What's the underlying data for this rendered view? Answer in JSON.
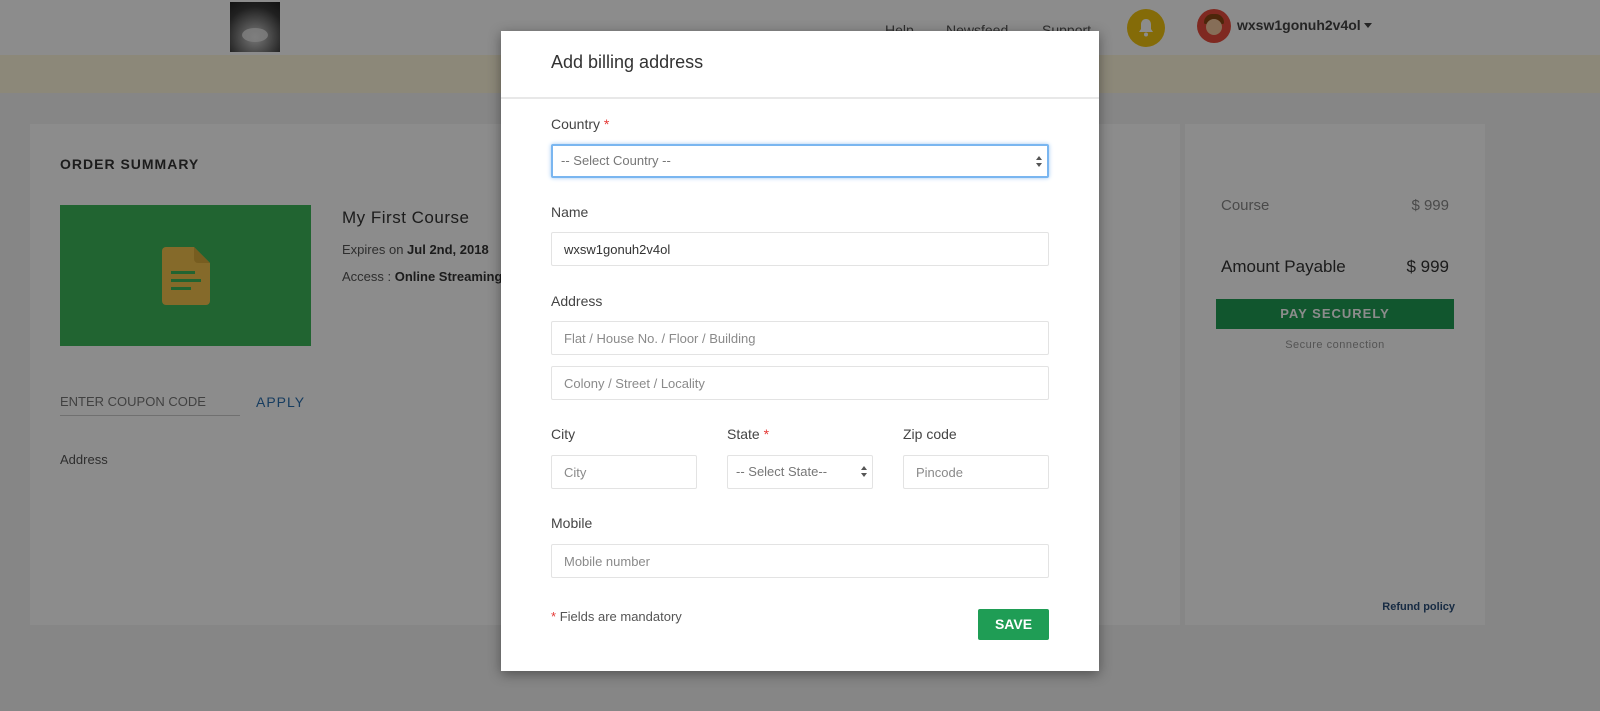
{
  "topbar": {
    "nav": [
      "Help",
      "Newsfeed",
      "Support"
    ],
    "username": "wxsw1gonuh2v4ol"
  },
  "order": {
    "title": "ORDER SUMMARY",
    "course_name": "My First Course",
    "expires_prefix": "Expires on",
    "expires_date": "Jul 2nd, 2018",
    "access_prefix": "Access :",
    "access_value": "Online Streaming",
    "coupon_placeholder": "ENTER COUPON CODE",
    "apply_label": "APPLY",
    "address_label": "Address"
  },
  "payment": {
    "course_label": "Course",
    "course_price": "$ 999",
    "payable_label": "Amount Payable",
    "payable_price": "$ 999",
    "pay_button": "PAY SECURELY",
    "secure_text": "Secure connection",
    "refund_link": "Refund policy"
  },
  "modal": {
    "title": "Add billing address",
    "country_label": "Country",
    "country_value": "-- Select Country --",
    "name_label": "Name",
    "name_value": "wxsw1gonuh2v4ol",
    "address_label": "Address",
    "address_line1_placeholder": "Flat / House No. / Floor / Building",
    "address_line2_placeholder": "Colony / Street / Locality",
    "city_label": "City",
    "city_placeholder": "City",
    "state_label": "State",
    "state_value": "-- Select State--",
    "zip_label": "Zip code",
    "zip_placeholder": "Pincode",
    "mobile_label": "Mobile",
    "mobile_placeholder": "Mobile number",
    "required_mark": "*",
    "mandatory_note": "Fields are mandatory",
    "save_label": "SAVE"
  },
  "colors": {
    "accent_green": "#1f9d55",
    "required_red": "#e53935",
    "focus_blue": "#7ab6f0",
    "bell_yellow": "#f1c40f"
  }
}
